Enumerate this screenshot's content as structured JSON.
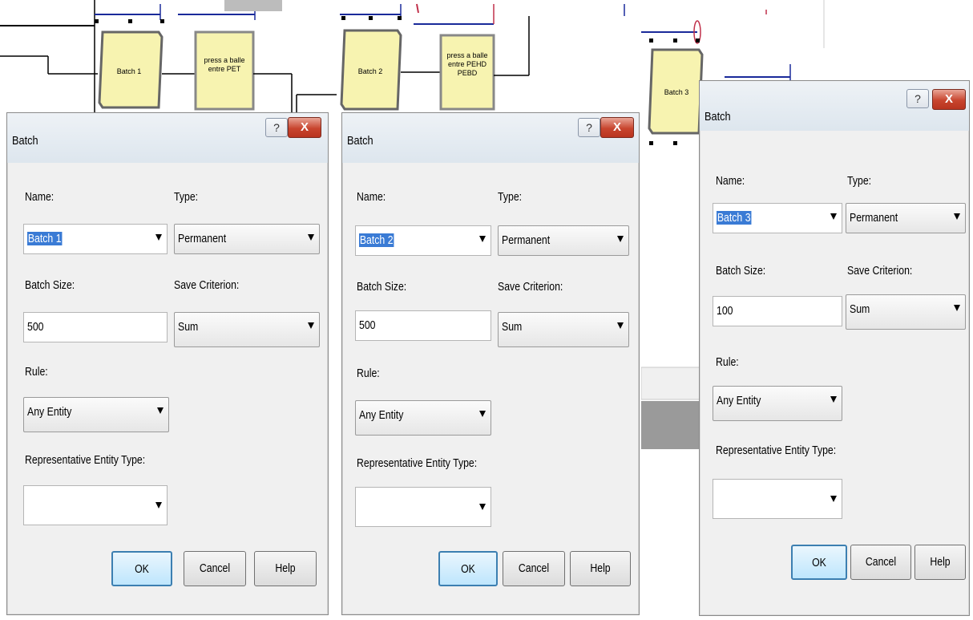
{
  "diagram": {
    "blocks": [
      {
        "label_lines": [
          "Batch 1"
        ]
      },
      {
        "label_lines": [
          "press a balle",
          "entre PET"
        ]
      },
      {
        "label_lines": [
          "Batch 2"
        ]
      },
      {
        "label_lines": [
          "press a balle",
          "entre PEHD",
          "PEBD"
        ]
      },
      {
        "label_lines": [
          "Batch 3"
        ]
      }
    ]
  },
  "dialogs": [
    {
      "title": "Batch",
      "help_glyph": "?",
      "close_glyph": "X",
      "name_label": "Name:",
      "name_value": "Batch 1",
      "type_label": "Type:",
      "type_value": "Permanent",
      "batch_size_label": "Batch Size:",
      "batch_size_value": "500",
      "save_criterion_label": "Save Criterion:",
      "save_criterion_value": "Sum",
      "rule_label": "Rule:",
      "rule_value": "Any Entity",
      "rep_type_label": "Representative Entity Type:",
      "rep_type_value": "",
      "ok_label": "OK",
      "cancel_label": "Cancel",
      "help_label": "Help"
    },
    {
      "title": "Batch",
      "help_glyph": "?",
      "close_glyph": "X",
      "name_label": "Name:",
      "name_value": "Batch 2",
      "type_label": "Type:",
      "type_value": "Permanent",
      "batch_size_label": "Batch Size:",
      "batch_size_value": "500",
      "save_criterion_label": "Save Criterion:",
      "save_criterion_value": "Sum",
      "rule_label": "Rule:",
      "rule_value": "Any Entity",
      "rep_type_label": "Representative Entity Type:",
      "rep_type_value": "",
      "ok_label": "OK",
      "cancel_label": "Cancel",
      "help_label": "Help"
    },
    {
      "title": "Batch",
      "help_glyph": "?",
      "close_glyph": "X",
      "name_label": "Name:",
      "name_value": "Batch 3",
      "type_label": "Type:",
      "type_value": "Permanent",
      "batch_size_label": "Batch Size:",
      "batch_size_value": "100",
      "save_criterion_label": "Save Criterion:",
      "save_criterion_value": "Sum",
      "rule_label": "Rule:",
      "rule_value": "Any Entity",
      "rep_type_label": "Representative Entity Type:",
      "rep_type_value": "",
      "ok_label": "OK",
      "cancel_label": "Cancel",
      "help_label": "Help"
    }
  ],
  "colors": {
    "block_fill": "#f7f3b0",
    "selection": "#3a7bd5",
    "close_button": "#c8452e",
    "connector_blue": "#1a2a9a",
    "connector_red": "#c0304a"
  }
}
